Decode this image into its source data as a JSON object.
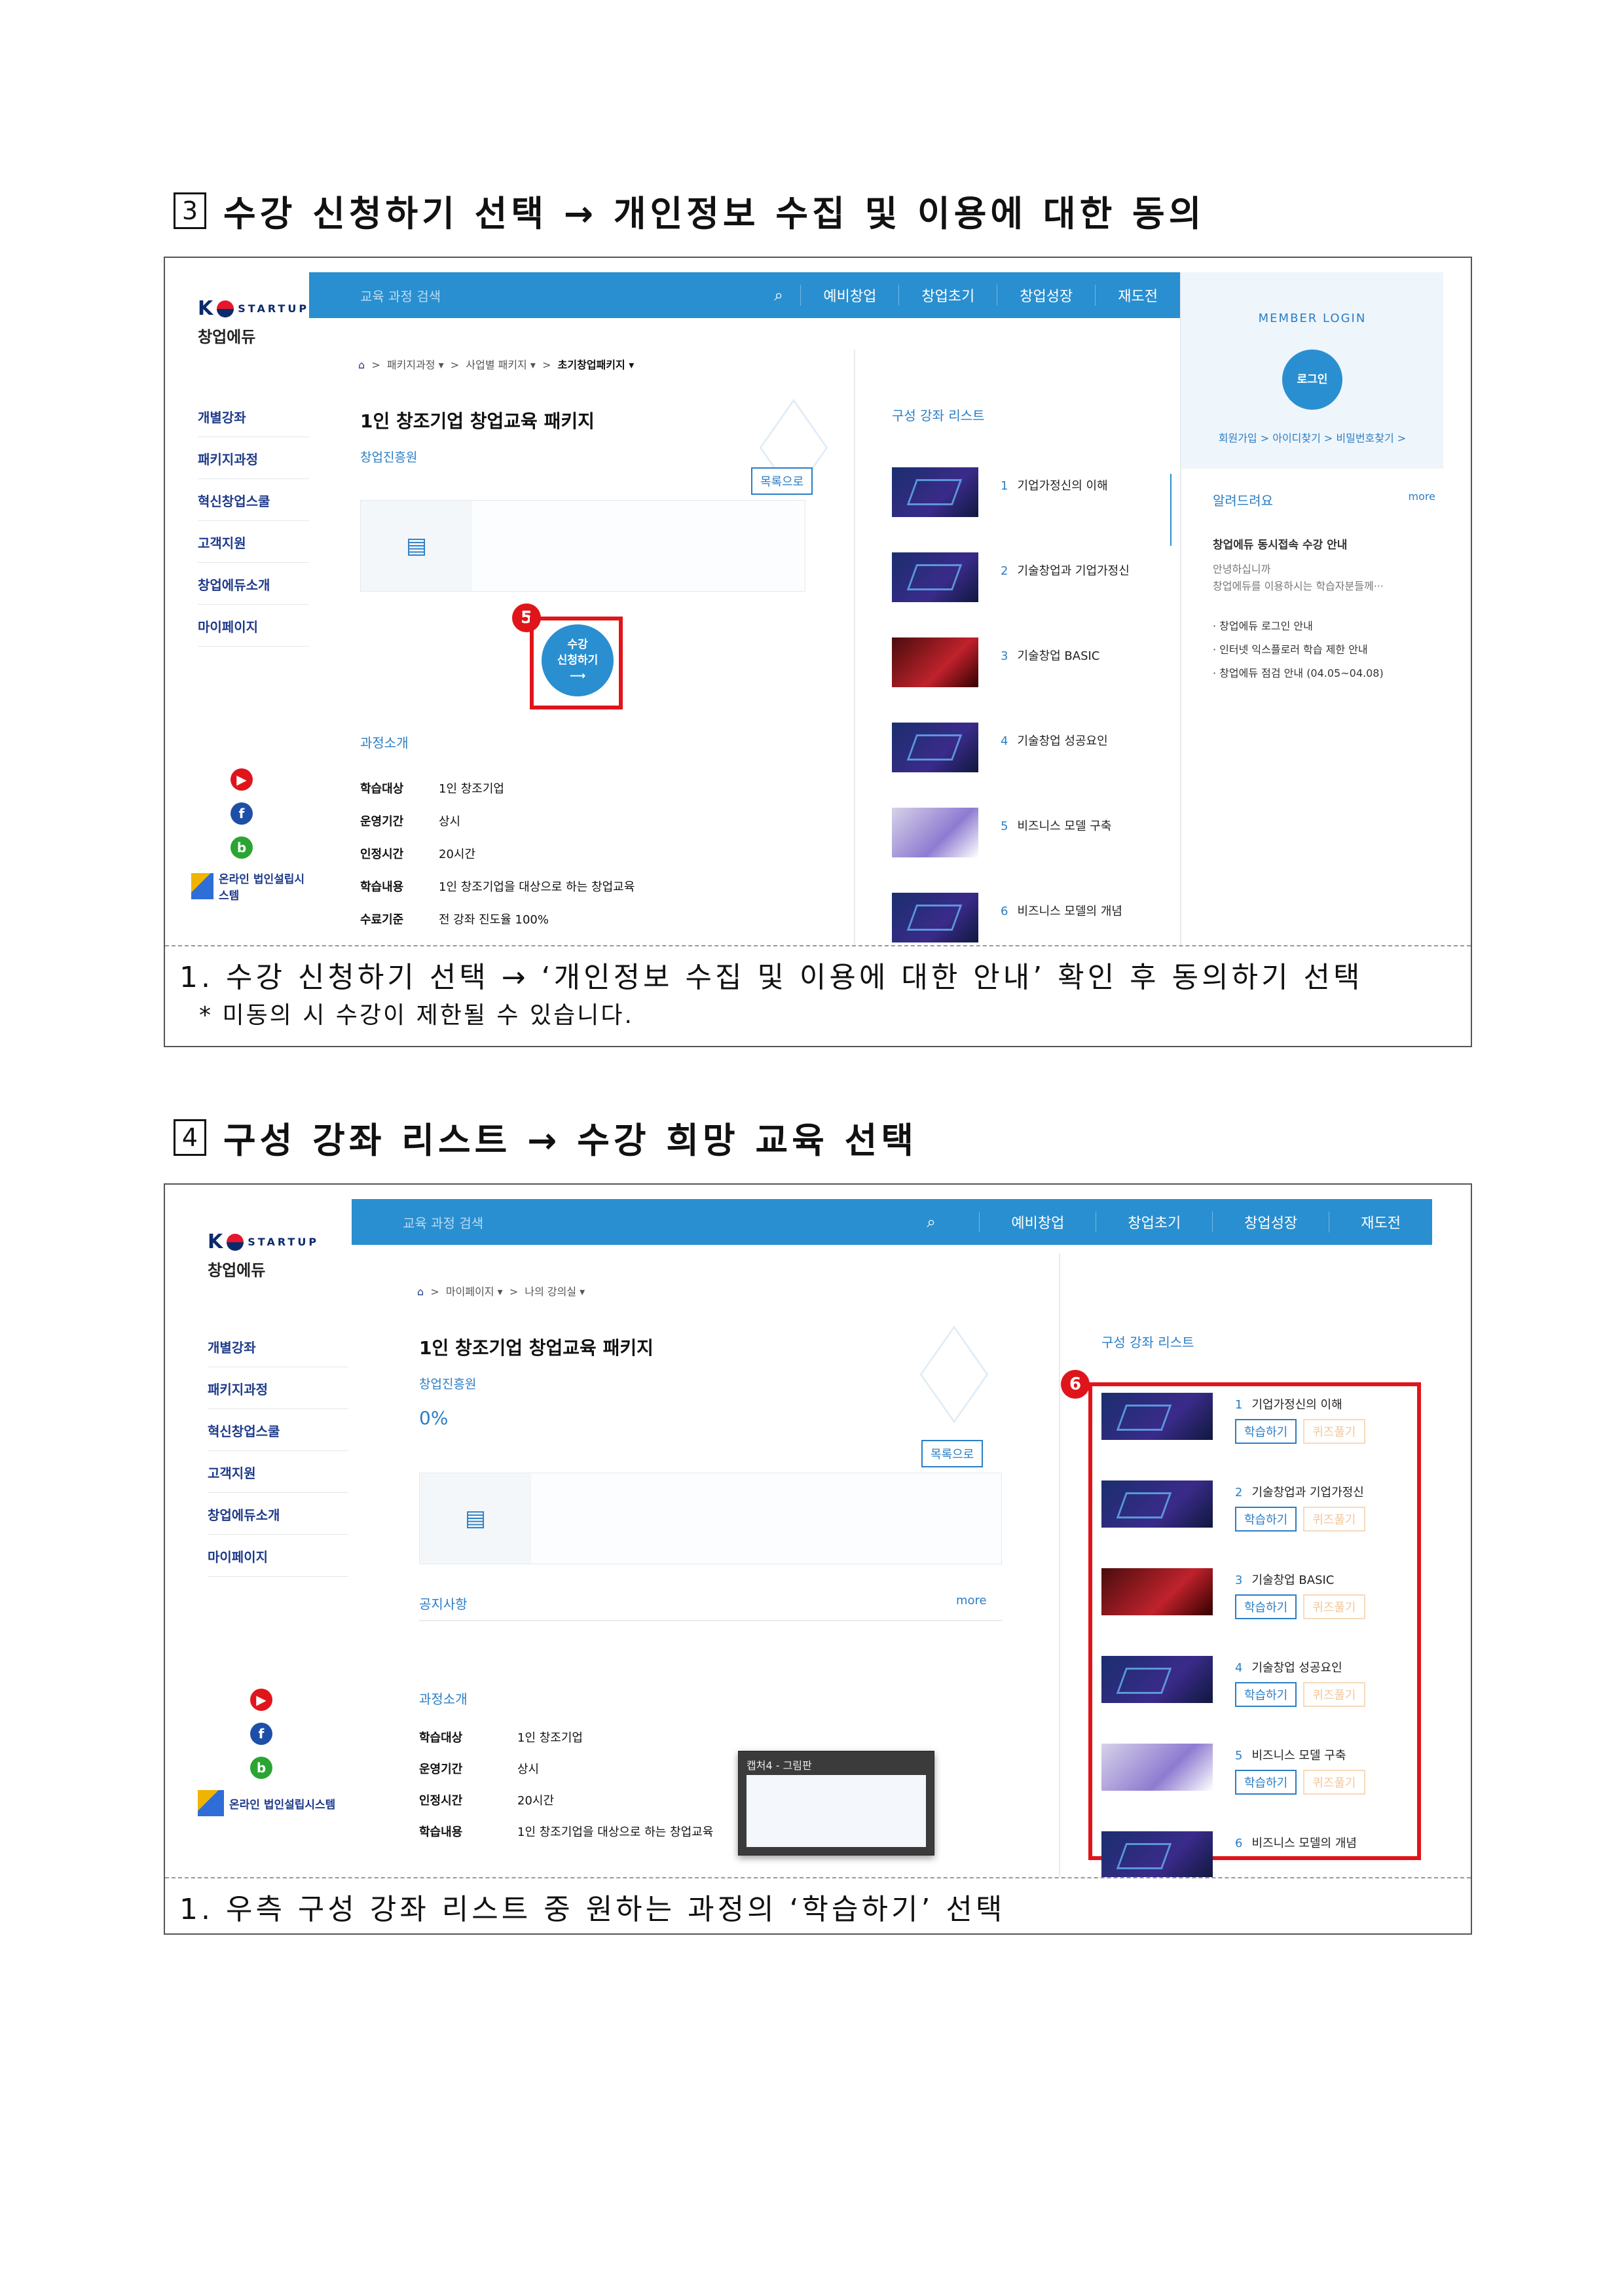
{
  "section3": {
    "num": "3",
    "title": "수강 신청하기 선택 → 개인정보 수집 및 이용에 대한 동의",
    "caption": "1. 수강 신청하기 선택 → ‘개인정보 수집 및 이용에 대한 안내’ 확인 후 동의하기 선택",
    "note": "* 미동의 시 수강이 제한될 수 있습니다.",
    "screen": {
      "logo_k": "K",
      "logo_startup": "STARTUP",
      "logo_edu": "창업에듀",
      "nav": [
        "개별강좌",
        "패키지과정",
        "혁신창업스쿨",
        "고객지원",
        "창업에듀소개",
        "마이페이지"
      ],
      "brand": "온라인 법인설립시스템",
      "search_placeholder": "교육 과정 검색",
      "menu": [
        "예비창업",
        "창업초기",
        "창업성장",
        "재도전"
      ],
      "breadcrumb": [
        "패키지과정 ▾",
        "사업별 패키지 ▾",
        "초기창업패키지 ▾"
      ],
      "course_title": "1인 창조기업 창업교육 패키지",
      "org": "창업진흥원",
      "list_button": "목록으로",
      "badge": "5",
      "apply_line1": "수강",
      "apply_line2": "신청하기",
      "apply_arrow": "⟶",
      "intro_title": "과정소개",
      "info": [
        {
          "k": "학습대상",
          "v": "1인 창조기업"
        },
        {
          "k": "운영기간",
          "v": "상시"
        },
        {
          "k": "인정시간",
          "v": "20시간"
        },
        {
          "k": "학습내용",
          "v": "1인 창조기업을 대상으로 하는 창업교육"
        },
        {
          "k": "수료기준",
          "v": "전 강좌 진도율 100%"
        }
      ],
      "lecture_list_title": "구성 강좌 리스트",
      "lectures": [
        {
          "n": "1",
          "t": "기업가정신의 이해"
        },
        {
          "n": "2",
          "t": "기술창업과 기업가정신"
        },
        {
          "n": "3",
          "t": "기술창업 BASIC"
        },
        {
          "n": "4",
          "t": "기술창업 성공요인"
        },
        {
          "n": "5",
          "t": "비즈니스 모델 구축"
        },
        {
          "n": "6",
          "t": "비즈니스 모델의 개념"
        }
      ],
      "login_title": "MEMBER LOGIN",
      "login_button": "로그인",
      "login_links": "회원가입 >   아이디찾기 >   비밀번호찾기 >",
      "notice_title": "알려드려요",
      "notice_more": "more",
      "notice_main": "창업에듀 동시접속 수강 안내",
      "notice_msg1": "안녕하십니까",
      "notice_msg2": "창업에듀를 이용하시는 학습자분들께···",
      "notice_items": [
        "· 창업에듀 로그인 안내",
        "· 인터넷 익스플로러 학습 제한 안내",
        "· 창업에듀 점검 안내 (04.05~04.08)"
      ]
    }
  },
  "section4": {
    "num": "4",
    "title": "구성 강좌 리스트 → 수강 희망 교육 선택",
    "caption": "1. 우측 구성 강좌 리스트 중 원하는 과정의 ‘학습하기’ 선택",
    "screen": {
      "breadcrumb": [
        "마이페이지 ▾",
        "나의 강의실 ▾"
      ],
      "progress": "0%",
      "notice_title": "공지사항",
      "notice_more": "more",
      "badge": "6",
      "study_label": "학습하기",
      "quiz_label": "퀴즈풀기",
      "popup_title": "캡처4 - 그림판"
    }
  }
}
